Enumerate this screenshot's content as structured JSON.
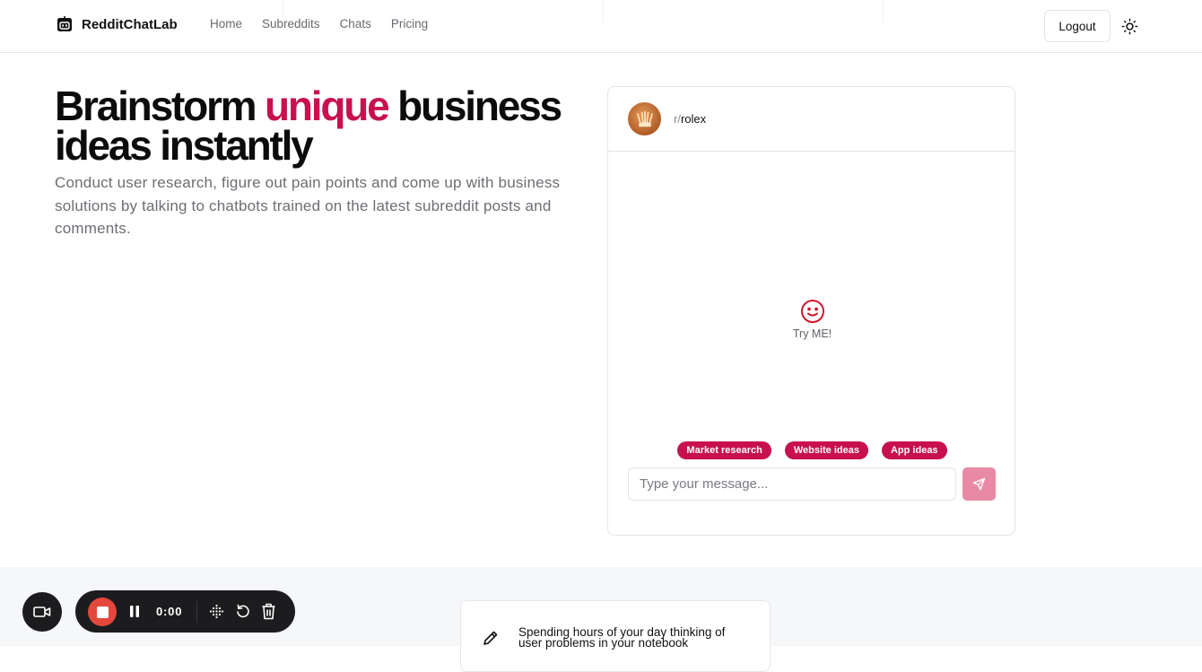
{
  "nav": {
    "brand": "RedditChatLab",
    "links": [
      "Home",
      "Subreddits",
      "Chats",
      "Pricing"
    ],
    "logout_label": "Logout",
    "theme_icon": "sun-icon"
  },
  "hero": {
    "title_before": "Brainstorm ",
    "title_accent": "unique",
    "title_after": " business ideas instantly",
    "subtitle": "Conduct user research, figure out pain points and come up with business solutions by talking to chatbots trained on the latest subreddit posts and comments.",
    "accent_color": "#c8104f"
  },
  "chat": {
    "subreddit_prefix": "r/",
    "subreddit_name": "rolex",
    "empty_state_icon": "smiley-icon",
    "empty_state_label": "Try ME!",
    "suggestions": [
      "Market research",
      "Website ideas",
      "App ideas"
    ],
    "input_placeholder": "Type your message...",
    "input_value": "",
    "send_icon": "send-icon"
  },
  "feature": {
    "icon": "pencil-icon",
    "text": "Spending hours of your day thinking of user problems in your notebook"
  },
  "recorder": {
    "time": "0:00",
    "stop_color": "#e4473b"
  }
}
